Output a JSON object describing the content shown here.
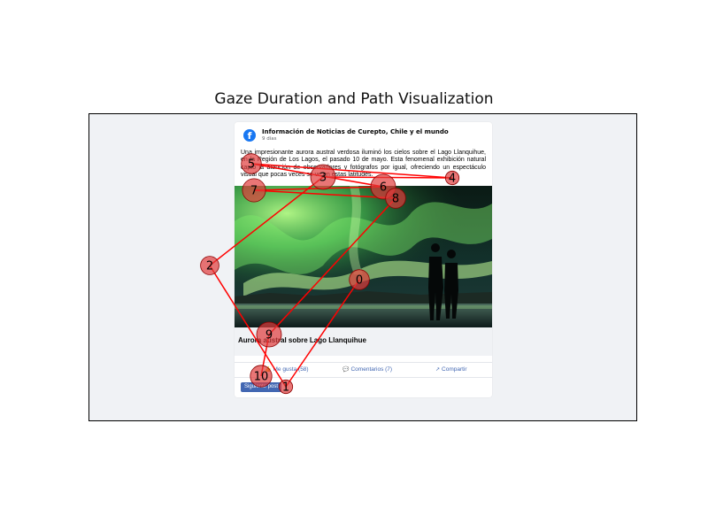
{
  "figure": {
    "title": "Gaze Duration and Path Visualization"
  },
  "post": {
    "page_name": "Información de Noticias de Curepto, Chile y el mundo",
    "time": "9 días",
    "text": "Una impresionante aurora austral verdosa iluminó los cielos sobre el Lago Llanquihue, en la Región de Los Lagos, el pasado 10 de mayo. Esta fenomenal exhibición natural captó la atención de observadores y fotógrafos por igual, ofreciendo un espectáculo visual que pocas veces se ve en estas latitudes.",
    "photo_title": "Aurora austral sobre Lago Llanquihue",
    "actions": {
      "like": "Me gusta (58)",
      "comments": "Comentarios (7)",
      "share": "Compartir"
    },
    "next_button": "Siguiente post"
  },
  "icons": {
    "logo": "facebook-logo-icon",
    "like": "thumbs-up-icon",
    "comment": "comment-bubble-icon",
    "share": "share-icon"
  },
  "colors": {
    "fixation_fill": "#e03c3c",
    "fixation_stroke": "#8b0000",
    "path": "#ff0000",
    "brand": "#1877f2",
    "button": "#4267b2"
  },
  "fixations": [
    {
      "label": "0",
      "duration": 0.7
    },
    {
      "label": "1",
      "duration": 0.3
    },
    {
      "label": "2",
      "duration": 0.6
    },
    {
      "label": "3",
      "duration": 1.0
    },
    {
      "label": "4",
      "duration": 0.3
    },
    {
      "label": "5",
      "duration": 0.7
    },
    {
      "label": "6",
      "duration": 1.0
    },
    {
      "label": "7",
      "duration": 0.9
    },
    {
      "label": "8",
      "duration": 0.7
    },
    {
      "label": "9",
      "duration": 1.0
    },
    {
      "label": "10",
      "duration": 0.8
    }
  ]
}
